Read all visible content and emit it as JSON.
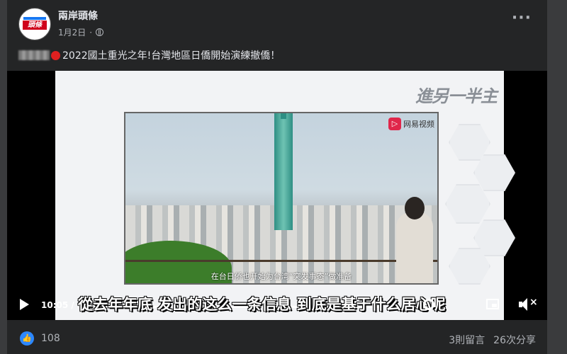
{
  "post": {
    "page_name": "兩岸頭條",
    "avatar_text": "頭條",
    "date": "1月2日",
    "text": "2022國土重光之年!台灣地區日僑開始演練撤僑！"
  },
  "video": {
    "watermark": "進另一半主",
    "netease_label": "网易视频",
    "netease_icon": "▷",
    "inner_subtitle": "在台日侨也开始为台湾“突发事态”做准备",
    "subtitle": "從去年年底 发出的这么一条信息 到底是基于什么居心呢",
    "time": "10:05 / 1",
    "progress": 0.88
  },
  "footer": {
    "like_icon": "👍",
    "like_count": "108",
    "comments": "3則留言",
    "shares": "26次分享"
  }
}
